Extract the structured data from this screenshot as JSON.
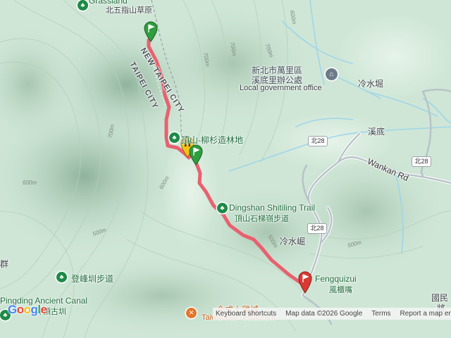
{
  "map": {
    "labels": {
      "grassland_en": "Grassland",
      "grassland_zh": "北五指山草原",
      "gov_office_zh1": "新北市萬里區",
      "gov_office_zh2": "溪底里辦公處",
      "gov_office_en": "Local government office",
      "lengshuiku_top": "冷水堀",
      "xidi": "溪底",
      "wankan_rd": "Wankan Rd",
      "dingshan_forest": "頂山-柳杉造林地",
      "dingshan_trail_en": "Dingshan Shitiling Trail",
      "dingshan_trail_zh": "頂山石梯嶺步道",
      "lengshuiku_mid": "冷水崛",
      "fengquizui_en": "Fengquizui",
      "fengquizui_zh": "風櫃嘴",
      "dengfengzhen": "登峰圳步道",
      "pingding_canal": "Pingding Ancient Canal",
      "pingding_zh": "坪頂古圳",
      "restaurant_zh": "全成土雞城",
      "restaurant_en": "Taiwanese restaurant",
      "guomin_1": "國民",
      "guomin_2": "將",
      "new_taipei_city": "NEW TAIPEI CITY",
      "taipei_city": "TAIPEI CITY",
      "partial_left": "群"
    },
    "road_shields": {
      "north28_a": "北28",
      "north28_b": "北28",
      "north28_c": "北28"
    },
    "contours": {
      "c700a": "700m",
      "c700b": "700m",
      "c700c": "700m",
      "c700d": "700m",
      "c600a": "600m",
      "c600b": "600m",
      "c600c": "600m",
      "c500a": "500m",
      "c500b": "500m",
      "c500c": "500m"
    },
    "footer": {
      "keyboard": "Keyboard shortcuts",
      "mapdata": "Map data ©2026 Google",
      "terms": "Terms",
      "report": "Report a map error"
    },
    "logo": {
      "g1": "G",
      "o1": "o",
      "o2": "o",
      "g2": "g",
      "l": "l",
      "e": "e"
    },
    "colors": {
      "track": "#e8616f",
      "start_pin": "#2e9e3e",
      "end_pin": "#d93a33",
      "waypoint_pin": "#f2c318",
      "terrain_base": "#cfe6d6",
      "water": "#9fd6e8"
    }
  }
}
